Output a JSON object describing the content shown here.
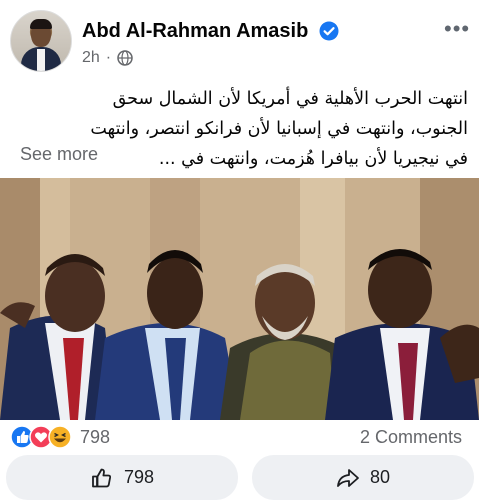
{
  "post": {
    "author": "Abd Al-Rahman Amasib",
    "time": "2h",
    "text_lines": [
      "انتهت الحرب الأهلية في أمريكا لأن الشمال سحق",
      "الجنوب، وانتهت في إسبانيا لأن فرانكو انتصر، وانتهت",
      "في نيجيريا لأن بيافرا هُزمت، وانتهت في ..."
    ],
    "see_more": "See more"
  },
  "stats": {
    "reactions_count": "798",
    "comments_label": "2 Comments"
  },
  "actions": {
    "like_count": "798",
    "share_count": "80"
  },
  "icons": {
    "verified": "verified-badge-icon",
    "audience": "globe-icon",
    "more": "more-options-icon",
    "like": "thumbs-up-icon",
    "share": "share-arrow-icon"
  },
  "colors": {
    "verified_blue": "#1877f2",
    "like_blue": "#1877f2",
    "love_red": "#f33e58",
    "haha_yellow": "#f7b125",
    "secondary_text": "#65676b",
    "button_bg": "#eef0f3"
  }
}
